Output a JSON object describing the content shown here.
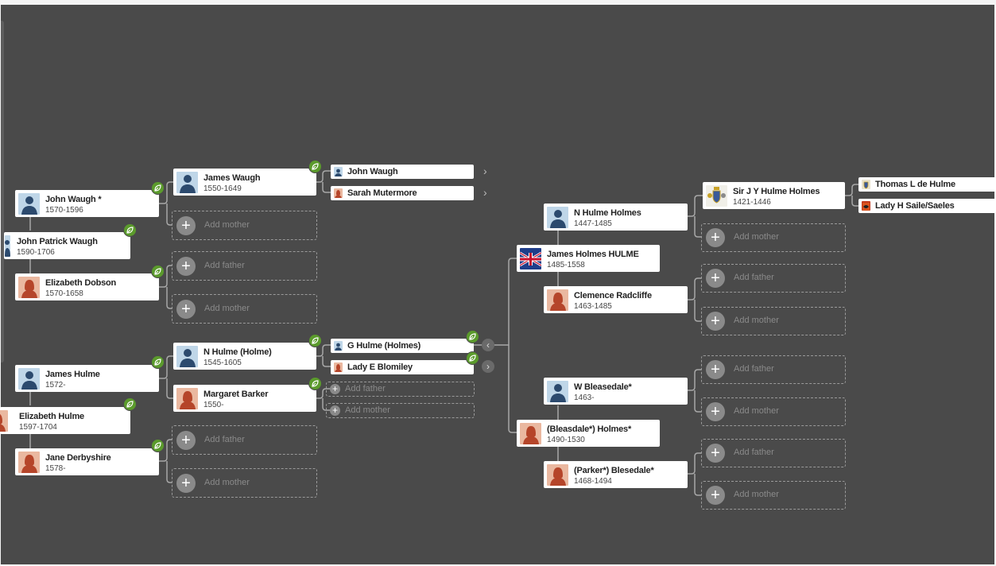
{
  "tree": {
    "people": {
      "john_waugh": {
        "name": "John Waugh *",
        "dates": "1570-1596"
      },
      "john_patrick_waugh": {
        "name": "John Patrick Waugh",
        "dates": "1590-1706"
      },
      "elizabeth_dobson": {
        "name": "Elizabeth Dobson",
        "dates": "1570-1658"
      },
      "james_waugh": {
        "name": "James Waugh",
        "dates": "1550-1649"
      },
      "james_hulme": {
        "name": "James Hulme",
        "dates": "1572-"
      },
      "elizabeth_hulme": {
        "name": "Elizabeth Hulme",
        "dates": "1597-1704"
      },
      "jane_derbyshire": {
        "name": "Jane Derbyshire",
        "dates": "1578-"
      },
      "n_hulme_holme": {
        "name": "N Hulme (Holme)",
        "dates": "1545-1605"
      },
      "margaret_barker": {
        "name": "Margaret Barker",
        "dates": "1550-"
      },
      "n_hulme_holmes": {
        "name": "N Hulme Holmes",
        "dates": "1447-1485"
      },
      "james_holmes_hulme": {
        "name": "James Holmes HULME",
        "dates": "1485-1558"
      },
      "clemence_radcliffe": {
        "name": "Clemence Radcliffe",
        "dates": "1463-1485"
      },
      "w_bleasedale": {
        "name": "W Bleasedale*",
        "dates": "1463-"
      },
      "bleasdale_holmes": {
        "name": "(Bleasdale*) Holmes*",
        "dates": "1490-1530"
      },
      "parker_blesedale": {
        "name": "(Parker*) Blesedale*",
        "dates": "1468-1494"
      },
      "sir_jy_hulme_holmes": {
        "name": "Sir J Y Hulme Holmes",
        "dates": "1421-1446"
      }
    },
    "minis": {
      "john_waugh_2": "John Waugh",
      "sarah_mutermore": "Sarah Mutermore",
      "g_hulme_holmes": "G Hulme (Holmes)",
      "lady_e_blomiley": "Lady E Blomiley",
      "thomas_l_de_hulme": "Thomas L de Hulme",
      "lady_h_saile": "Lady H Saile/Saeles"
    },
    "add_father_label": "Add father",
    "add_mother_label": "Add mother",
    "icons": {
      "male": "male-silhouette-icon",
      "female": "female-silhouette-icon",
      "hint": "record-hint-leaf-icon",
      "flag": "union-jack-flag-icon",
      "crest": "coat-of-arms-icon",
      "plus": "plus-icon",
      "chevron": "chevron-right-icon"
    },
    "colors": {
      "background": "#4a4a4a",
      "card": "#ffffff",
      "hint": "#5b9b2c",
      "male_avatar": "#bfd6e8",
      "female_avatar": "#eab8a0",
      "dashed": "#9a9a9a"
    }
  }
}
